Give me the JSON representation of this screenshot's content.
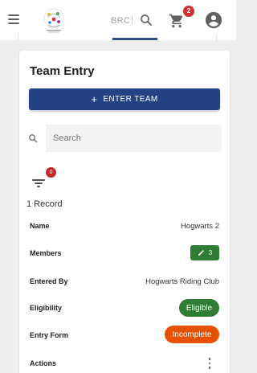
{
  "header": {
    "brand": "BRC",
    "cart_count": "2",
    "menu_icon": "hamburger-menu-icon",
    "search_icon": "search-icon",
    "cart_icon": "shopping-cart-icon",
    "account_icon": "account-circle-icon"
  },
  "card": {
    "title": "Team Entry",
    "enter_button": {
      "icon": "+",
      "label": "ENTER TEAM"
    },
    "search": {
      "placeholder": "Search",
      "value": ""
    },
    "filter": {
      "badge": "0"
    },
    "record_count": "1 Record",
    "rows": {
      "name": {
        "label": "Name",
        "value": "Hogwarts 2"
      },
      "members": {
        "label": "Members",
        "count": "3"
      },
      "entered_by": {
        "label": "Entered By",
        "value": "Hogwarts Riding Club"
      },
      "eligibility": {
        "label": "Eligibility",
        "status": "Eligible"
      },
      "entry_form": {
        "label": "Entry Form",
        "status": "Incomplete"
      },
      "actions": {
        "label": "Actions"
      }
    }
  },
  "colors": {
    "primary": "#254284",
    "success": "#2e7d32",
    "warning": "#e65100",
    "badge": "#d32f2f"
  }
}
